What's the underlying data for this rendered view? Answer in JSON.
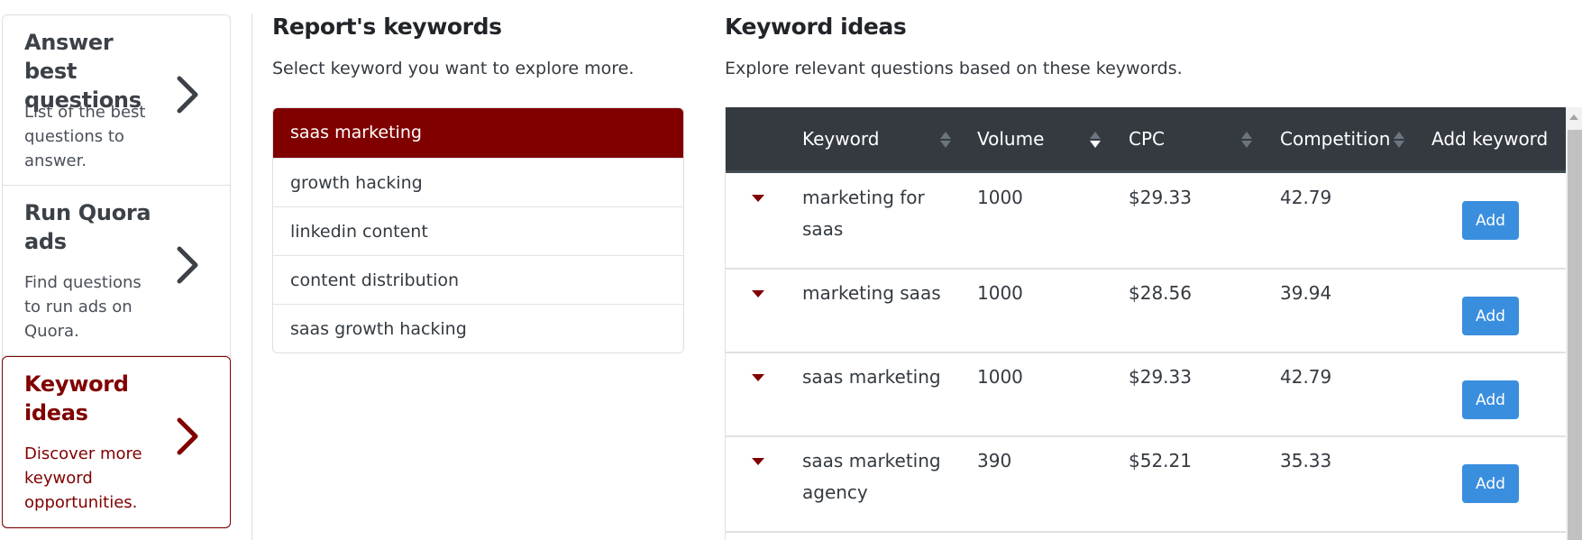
{
  "sidebar": {
    "items": [
      {
        "title": "Answer best questions",
        "description": "List of the best questions to answer.",
        "active": false
      },
      {
        "title": "Run Quora ads",
        "description": "Find questions to run ads on Quora.",
        "active": false
      },
      {
        "title": "Keyword ideas",
        "description": "Discover more keyword opportunities.",
        "active": true
      }
    ],
    "icon": "chevron-right-icon"
  },
  "report_keywords": {
    "title": "Report's keywords",
    "subtitle": "Select keyword you want to explore more.",
    "selected": "saas marketing",
    "items": [
      "saas marketing",
      "growth hacking",
      "linkedin content",
      "content distribution",
      "saas growth hacking"
    ]
  },
  "keyword_ideas": {
    "title": "Keyword ideas",
    "subtitle": "Explore relevant questions based on these keywords.",
    "columns": {
      "keyword": "Keyword",
      "volume": "Volume",
      "cpc": "CPC",
      "competition": "Competition",
      "add_keyword": "Add keyword"
    },
    "sort": {
      "column": "volume",
      "direction": "desc"
    },
    "rows": [
      {
        "keyword": "marketing for saas",
        "volume": "1000",
        "cpc": "$29.33",
        "competition": "42.79",
        "action": "Add"
      },
      {
        "keyword": "marketing saas",
        "volume": "1000",
        "cpc": "$28.56",
        "competition": "39.94",
        "action": "Add"
      },
      {
        "keyword": "saas marketing",
        "volume": "1000",
        "cpc": "$29.33",
        "competition": "42.79",
        "action": "Add"
      },
      {
        "keyword": "saas marketing agency",
        "volume": "390",
        "cpc": "$52.21",
        "competition": "35.33",
        "action": "Add"
      }
    ]
  },
  "colors": {
    "accent": "#800000",
    "table_header": "#343a40",
    "add_button": "#3a8ede"
  }
}
